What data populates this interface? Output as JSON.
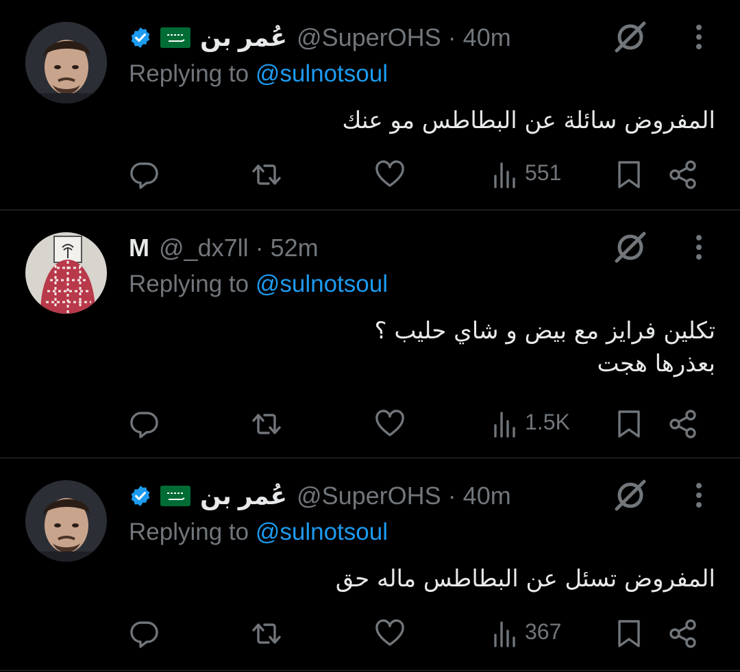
{
  "colors": {
    "background": "#000000",
    "text_primary": "#e7e9ea",
    "text_secondary": "#71767b",
    "accent": "#1d9bf0",
    "divider": "#2f3336",
    "flag_green": "#006c35"
  },
  "tweets": [
    {
      "display_name": "عُمر بن",
      "handle": "@SuperOHS",
      "separator": "·",
      "time": "40m",
      "verified": true,
      "flag_icon": "saudi-flag-icon",
      "replying_prefix": "Replying to",
      "replying_to": "@sulnotsoul",
      "text": "المفروض سائلة عن البطاطس مو عنك",
      "views": "551"
    },
    {
      "display_name": "M",
      "handle": "@_dx7ll",
      "separator": "·",
      "time": "52m",
      "verified": false,
      "replying_prefix": "Replying to",
      "replying_to": "@sulnotsoul",
      "text": "تكلين فرايز مع بيض  و شاي حليب ؟\nبعذرها هجت",
      "views": "1.5K"
    },
    {
      "display_name": "عُمر بن",
      "handle": "@SuperOHS",
      "separator": "·",
      "time": "40m",
      "verified": true,
      "flag_icon": "saudi-flag-icon",
      "replying_prefix": "Replying to",
      "replying_to": "@sulnotsoul",
      "text": "المفروض تسئل عن البطاطس ماله حق",
      "views": "367"
    }
  ]
}
